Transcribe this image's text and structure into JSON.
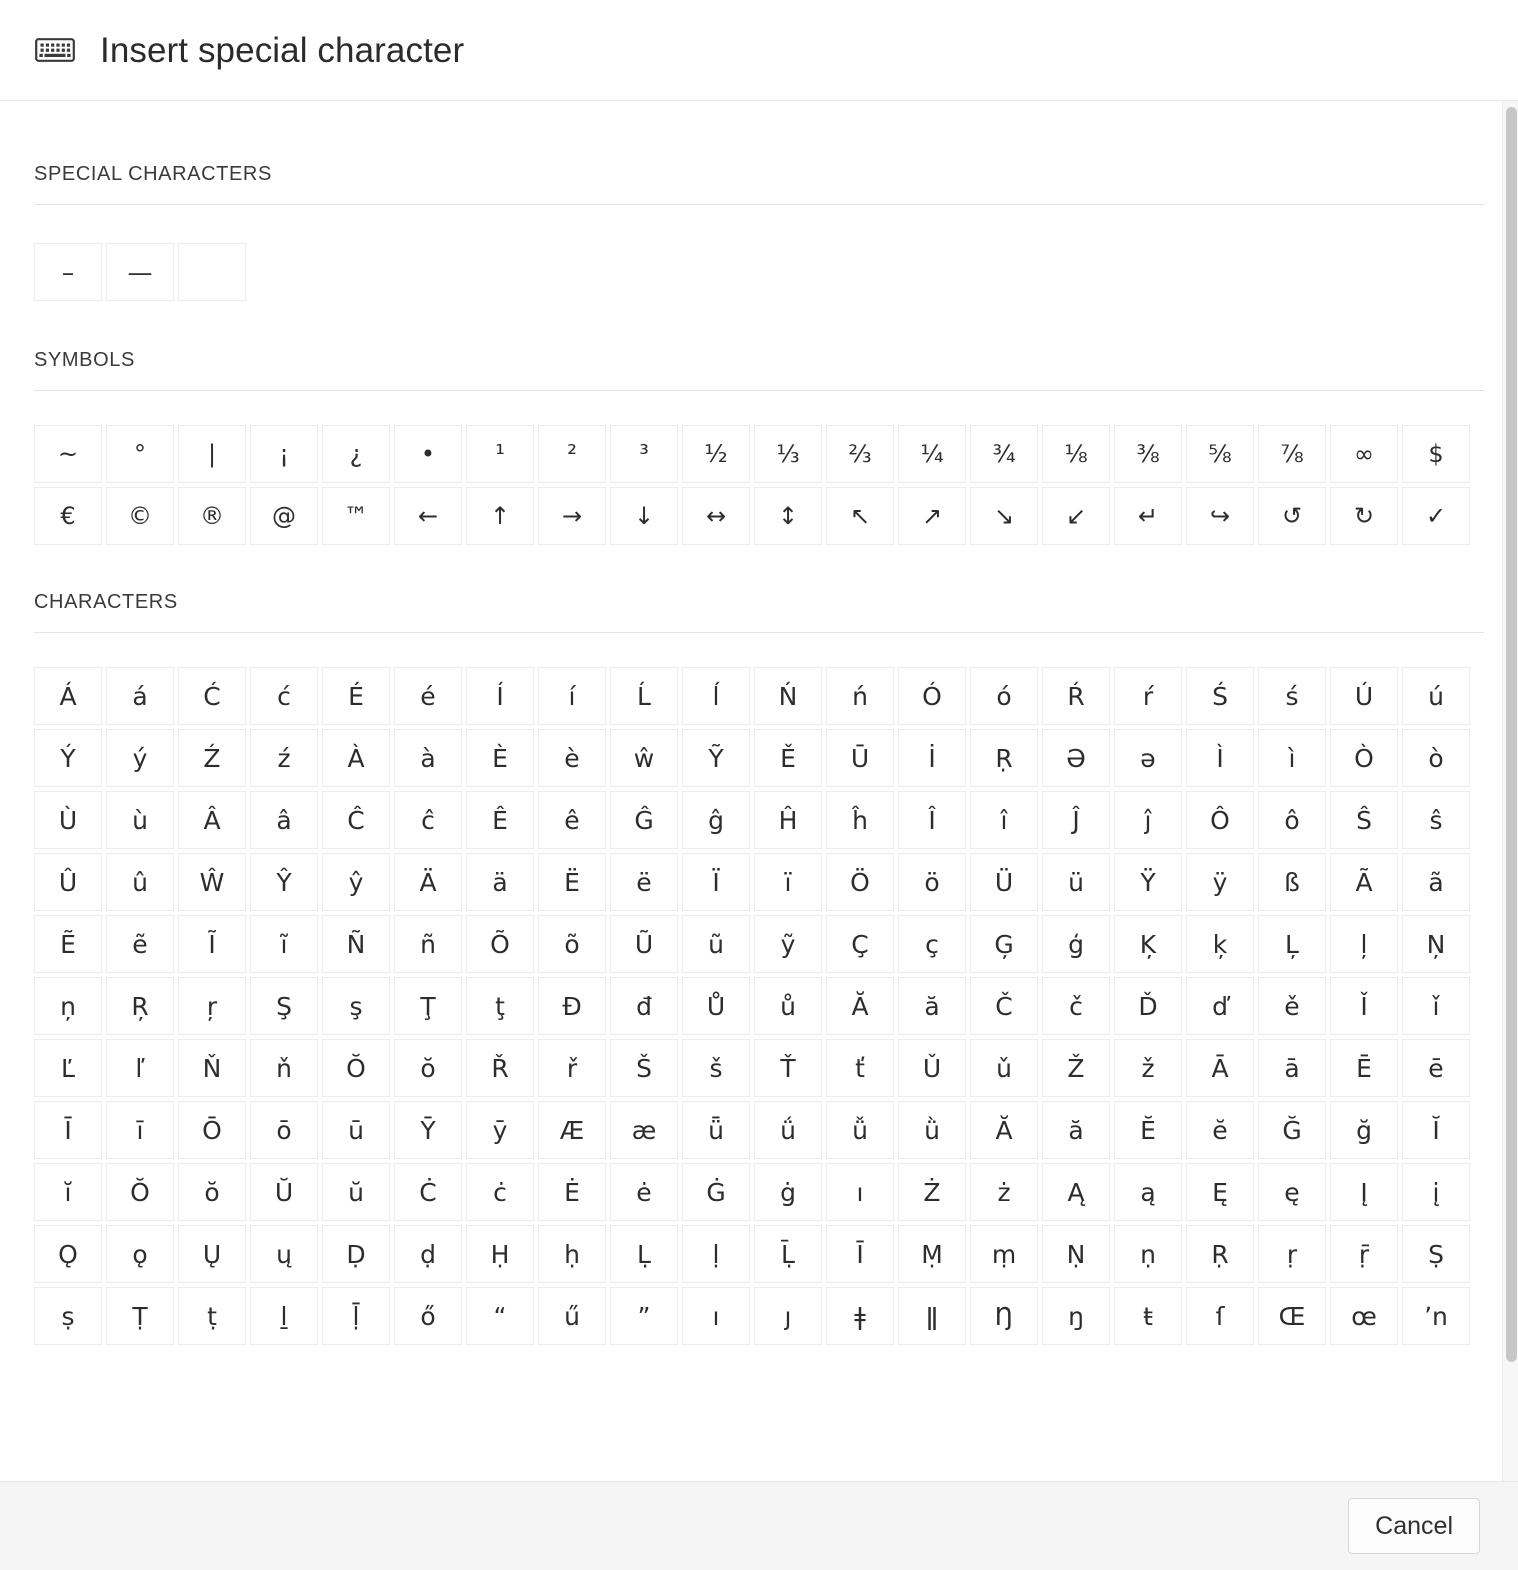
{
  "header": {
    "icon": "keyboard-icon",
    "title": "Insert special character"
  },
  "sections": [
    {
      "id": "special-characters",
      "label": "SPECIAL CHARACTERS",
      "chars": [
        "–",
        "—",
        " "
      ]
    },
    {
      "id": "symbols",
      "label": "SYMBOLS",
      "chars": [
        "~",
        "°",
        "|",
        "¡",
        "¿",
        "•",
        "¹",
        "²",
        "³",
        "½",
        "⅓",
        "⅔",
        "¼",
        "¾",
        "⅛",
        "⅜",
        "⅝",
        "⅞",
        "∞",
        "$",
        "€",
        "©",
        "®",
        "@",
        "™",
        "←",
        "↑",
        "→",
        "↓",
        "↔",
        "↕",
        "↖",
        "↗",
        "↘",
        "↙",
        "↵",
        "↪",
        "↺",
        "↻",
        "✓"
      ]
    },
    {
      "id": "characters",
      "label": "CHARACTERS",
      "chars": [
        "Á",
        "á",
        "Ć",
        "ć",
        "É",
        "é",
        "Í",
        "í",
        "Ĺ",
        "ĺ",
        "Ń",
        "ń",
        "Ó",
        "ó",
        "Ŕ",
        "ŕ",
        "Ś",
        "ś",
        "Ú",
        "ú",
        "Ý",
        "ý",
        "Ź",
        "ź",
        "À",
        "à",
        "È",
        "è",
        "ŵ",
        "Ỹ",
        "Ě",
        "Ū",
        "İ",
        "Ṛ",
        "Ə",
        "ə",
        "Ì",
        "ì",
        "Ò",
        "ò",
        "Ù",
        "ù",
        "Â",
        "â",
        "Ĉ",
        "ĉ",
        "Ê",
        "ê",
        "Ĝ",
        "ĝ",
        "Ĥ",
        "ĥ",
        "Î",
        "î",
        "Ĵ",
        "ĵ",
        "Ô",
        "ô",
        "Ŝ",
        "ŝ",
        "Û",
        "û",
        "Ŵ",
        "Ŷ",
        "ŷ",
        "Ä",
        "ä",
        "Ë",
        "ë",
        "Ï",
        "ï",
        "Ö",
        "ö",
        "Ü",
        "ü",
        "Ÿ",
        "ÿ",
        "ß",
        "Ã",
        "ã",
        "Ẽ",
        "ẽ",
        "Ĩ",
        "ĩ",
        "Ñ",
        "ñ",
        "Õ",
        "õ",
        "Ũ",
        "ũ",
        "ỹ",
        "Ç",
        "ç",
        "Ģ",
        "ģ",
        "Ķ",
        "ķ",
        "Ļ",
        "ļ",
        "Ņ",
        "ņ",
        "Ŗ",
        "ŗ",
        "Ş",
        "ş",
        "Ţ",
        "ţ",
        "Đ",
        "đ",
        "Ů",
        "ů",
        "Ă",
        "ă",
        "Č",
        "č",
        "Ď",
        "ď",
        "ě",
        "Ǐ",
        "ǐ",
        "Ľ",
        "ľ",
        "Ň",
        "ň",
        "Ŏ",
        "ŏ",
        "Ř",
        "ř",
        "Š",
        "š",
        "Ť",
        "ť",
        "Ǔ",
        "ǔ",
        "Ž",
        "ž",
        "Ā",
        "ā",
        "Ē",
        "ē",
        "Ī",
        "ī",
        "Ō",
        "ō",
        "ū",
        "Ȳ",
        "ȳ",
        "Æ",
        "æ",
        "ǖ",
        "ǘ",
        "ǚ",
        "ǜ",
        "Ă",
        "ă",
        "Ĕ",
        "ĕ",
        "Ğ",
        "ğ",
        "Ĭ",
        "ĭ",
        "Ŏ",
        "ŏ",
        "Ŭ",
        "ŭ",
        "Ċ",
        "ċ",
        "Ė",
        "ė",
        "Ġ",
        "ġ",
        "ı",
        "Ż",
        "ż",
        "Ą",
        "ą",
        "Ę",
        "ę",
        "Į",
        "į",
        "Ǫ",
        "ǫ",
        "Ų",
        "ų",
        "Ḍ",
        "ḍ",
        "Ḥ",
        "ḥ",
        "Ḷ",
        "ḷ",
        "Ḹ",
        "Ī",
        "Ṃ",
        "ṃ",
        "Ṇ",
        "ṇ",
        "Ṛ",
        "ṛ",
        "ṝ",
        "Ṣ",
        "ṣ",
        "Ṭ",
        "ṭ",
        "ḻ",
        "ḹ",
        "ő",
        "“",
        "ű",
        "”",
        "ı",
        "ȷ",
        "ǂ",
        "ǁ",
        "Ŋ",
        "ŋ",
        "ŧ",
        "ſ",
        "Œ",
        "œ",
        "ʼn"
      ]
    }
  ],
  "footer": {
    "cancel_label": "Cancel"
  },
  "colors": {
    "background": "#ffffff",
    "footer_background": "#f5f5f5",
    "cell_border": "#ececec",
    "text": "#2d2d2d",
    "scrollbar_thumb": "#c7c7c7"
  }
}
